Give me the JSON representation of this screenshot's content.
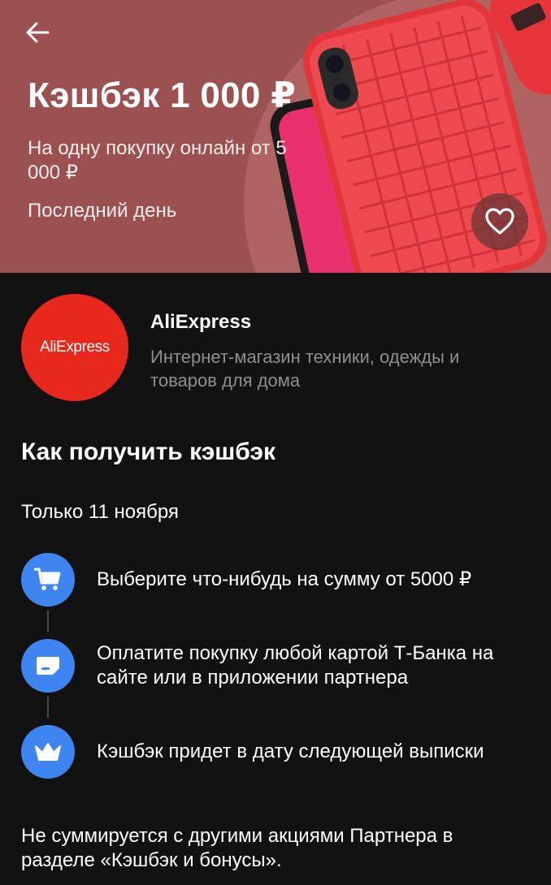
{
  "banner": {
    "title": "Кэшбэк 1 000 ₽",
    "subtitle": "На одну покупку онлайн от 5 000 ₽",
    "note": "Последний день",
    "background_color": "#9a5150"
  },
  "partner": {
    "logo_text": "AliExpress",
    "name": "AliExpress",
    "description": "Интернет-магазин техники, одежды и товаров для дома",
    "brand_color": "#e8281d"
  },
  "how_to": {
    "title": "Как получить кэшбэк",
    "date_note": "Только 11 ноября",
    "step_color": "#3f85f1",
    "steps": [
      {
        "icon": "cart-icon",
        "text": "Выберите что-нибудь на сумму от 5000 ₽"
      },
      {
        "icon": "card-icon",
        "text": "Оплатите покупку любой картой Т-Банка на сайте или в приложении партнера"
      },
      {
        "icon": "crown-icon",
        "text": "Кэшбэк придет в дату следующей выписки"
      }
    ]
  },
  "footer": {
    "note": "Не суммируется с другими акциями Партнера в разделе «Кэшбэк и бонусы»."
  }
}
